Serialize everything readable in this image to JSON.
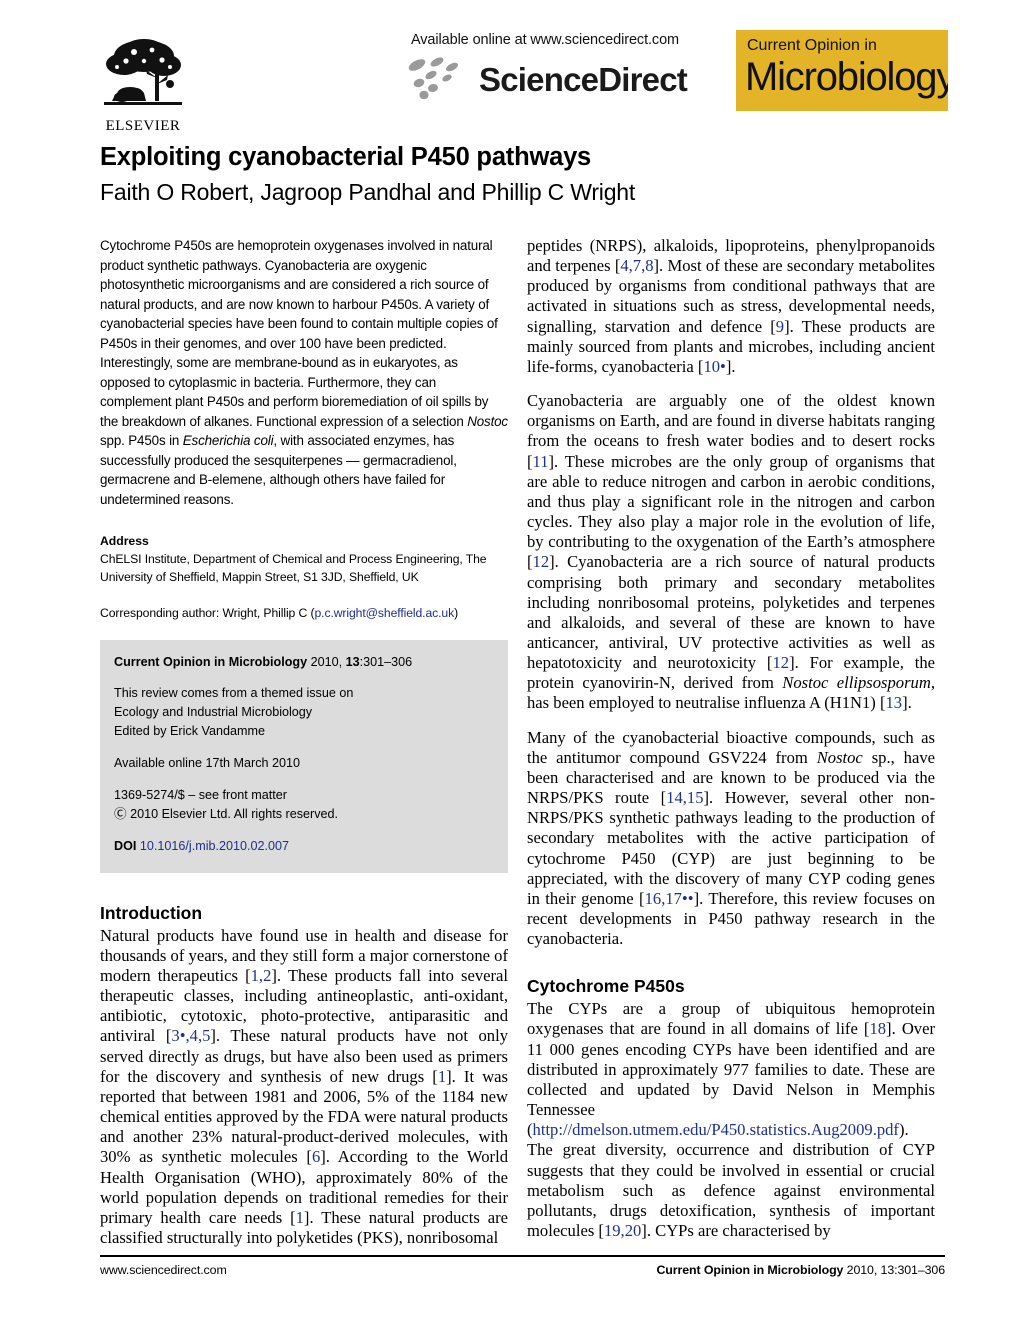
{
  "masthead": {
    "elsevier_label": "ELSEVIER",
    "available_online": "Available online at www.sciencedirect.com",
    "sciencedirect_wordmark": "ScienceDirect",
    "journal_logo_top": "Current Opinion in",
    "journal_logo_main": "Microbiology",
    "journal_logo_bg": "#e3b428"
  },
  "article": {
    "title": "Exploiting cyanobacterial P450 pathways",
    "authors": "Faith O Robert, Jagroop Pandhal and Phillip C Wright"
  },
  "abstract": {
    "text": "Cytochrome P450s are hemoprotein oxygenases involved in natural product synthetic pathways. Cyanobacteria are oxygenic photosynthetic microorganisms and are considered a rich source of natural products, and are now known to harbour P450s. A variety of cyanobacterial species have been found to contain multiple copies of P450s in their genomes, and over 100 have been predicted. Interestingly, some are membrane-bound as in eukaryotes, as opposed to cytoplasmic in bacteria. Furthermore, they can complement plant P450s and perform bioremediation of oil spills by the breakdown of alkanes. Functional expression of a selection ",
    "italic_1": "Nostoc",
    "text_2": " spp. P450s in ",
    "italic_2": "Escherichia coli",
    "text_3": ", with associated enzymes, has successfully produced the sesquiterpenes — germacradienol, germacrene and B-elemene, although others have failed for undetermined reasons."
  },
  "address": {
    "heading": "Address",
    "line1": "ChELSI Institute, Department of Chemical and Process Engineering, The",
    "line2": "University of Sheffield, Mappin Street, S1 3JD, Sheffield, UK",
    "corresponding_prefix": "Corresponding author: Wright, Phillip C (",
    "corresponding_email": "p.c.wright@sheffield.ac.uk",
    "corresponding_suffix": ")"
  },
  "infobox": {
    "journal_name": "Current Opinion in Microbiology",
    "journal_year_vol": " 2010, ",
    "journal_volume": "13",
    "journal_pages": ":301–306",
    "themed_line1": "This review comes from a themed issue on",
    "themed_line2": "Ecology and Industrial Microbiology",
    "themed_line3": "Edited by Erick Vandamme",
    "available_online": "Available online 17th March 2010",
    "front_matter": "1369-5274/$ – see front matter",
    "copyright": "Ⓒ 2010 Elsevier Ltd. All rights reserved.",
    "doi_label": "DOI",
    "doi_value": "10.1016/j.mib.2010.02.007"
  },
  "sections": {
    "introduction_heading": "Introduction",
    "cytochrome_heading": "Cytochrome P450s"
  },
  "body": {
    "intro_p1_a": "Natural products have found use in health and disease for thousands of years, and they still form a major cornerstone of modern therapeutics [",
    "intro_ref1": "1,2",
    "intro_p1_b": "]. These products fall into several therapeutic classes, including antineoplastic, anti-oxidant, antibiotic, cytotoxic, photo-protective, antiparasitic and antiviral [",
    "intro_ref2": "3•,4,5",
    "intro_p1_c": "]. These natural products have not only served directly as drugs, but have also been used as primers for the discovery and synthesis of new drugs [",
    "intro_ref3": "1",
    "intro_p1_d": "]. It was reported that between 1981 and 2006, 5% of the 1184 new chemical entities approved by the FDA were natural products and another 23% natural-product-derived molecules, with 30% as synthetic molecules [",
    "intro_ref4": "6",
    "intro_p1_e": "]. According to the World Health Organisation (WHO), approximately 80% of the world population depends on traditional remedies for their primary health care needs [",
    "intro_ref5": "1",
    "intro_p1_f": "]. These natural products are classified structurally into polyketides (PKS), nonribosomal",
    "right_p1_a": "peptides (NRPS), alkaloids, lipoproteins, phenylpropanoids and terpenes [",
    "right_ref1": "4,7,8",
    "right_p1_b": "]. Most of these are secondary metabolites produced by organisms from conditional pathways that are activated in situations such as stress, developmental needs, signalling, starvation and defence [",
    "right_ref2": "9",
    "right_p1_c": "]. These products are mainly sourced from plants and microbes, including ancient life-forms, cyanobacteria [",
    "right_ref3": "10•",
    "right_p1_d": "].",
    "right_p2_a": "Cyanobacteria are arguably one of the oldest known organisms on Earth, and are found in diverse habitats ranging from the oceans to fresh water bodies and to desert rocks [",
    "right_p2_ref1": "11",
    "right_p2_b": "]. These microbes are the only group of organisms that are able to reduce nitrogen and carbon in aerobic conditions, and thus play a significant role in the nitrogen and carbon cycles. They also play a major role in the evolution of life, by contributing to the oxygenation of the Earth’s atmosphere [",
    "right_p2_ref2": "12",
    "right_p2_c": "]. Cyanobacteria are a rich source of natural products comprising both primary and secondary metabolites including nonribosomal proteins, polyketides and terpenes and alkaloids, and several of these are known to have anticancer, antiviral, UV protective activities as well as hepatotoxicity and neurotoxicity [",
    "right_p2_ref3": "12",
    "right_p2_d": "]. For example, the protein cyanovirin-N, derived from ",
    "right_p2_italic1": "Nostoc ellipsosporum",
    "right_p2_e": ", has been employed to neutralise influenza A (H1N1) [",
    "right_p2_ref4": "13",
    "right_p2_f": "].",
    "right_p3_a": "Many of the cyanobacterial bioactive compounds, such as the antitumor compound GSV224 from ",
    "right_p3_italic1": "Nostoc",
    "right_p3_b": " sp., have been characterised and are known to be produced via the NRPS/PKS route [",
    "right_p3_ref1": "14,15",
    "right_p3_c": "]. However, several other non-NRPS/PKS synthetic pathways leading to the production of secondary metabolites with the active participation of cytochrome P450 (CYP) are just beginning to be appreciated, with the discovery of many CYP coding genes in their genome [",
    "right_p3_ref2": "16,17••",
    "right_p3_d": "]. Therefore, this review focuses on recent developments in P450 pathway research in the cyanobacteria.",
    "right_p4_a": "The CYPs are a group of ubiquitous hemoprotein oxygenases that are found in all domains of life [",
    "right_p4_ref1": "18",
    "right_p4_b": "]. Over 11 000 genes encoding CYPs have been identified and are distributed in approximately 977 families to date. These are collected and updated by David Nelson in Memphis Tennessee (",
    "right_p4_url": "http://dmelson.utmem.edu/P450.statistics.Aug2009.pdf",
    "right_p4_c": "). The great diversity, occurrence and distribution of CYP suggests that they could be involved in essential or crucial metabolism such as defence against environmental pollutants, drugs detoxification, synthesis of important molecules [",
    "right_p4_ref2": "19,20",
    "right_p4_d": "]. CYPs are characterised by"
  },
  "footer": {
    "left": "www.sciencedirect.com",
    "right_bold": "Current Opinion in Microbiology",
    "right_light": " 2010, 13:301–306"
  }
}
